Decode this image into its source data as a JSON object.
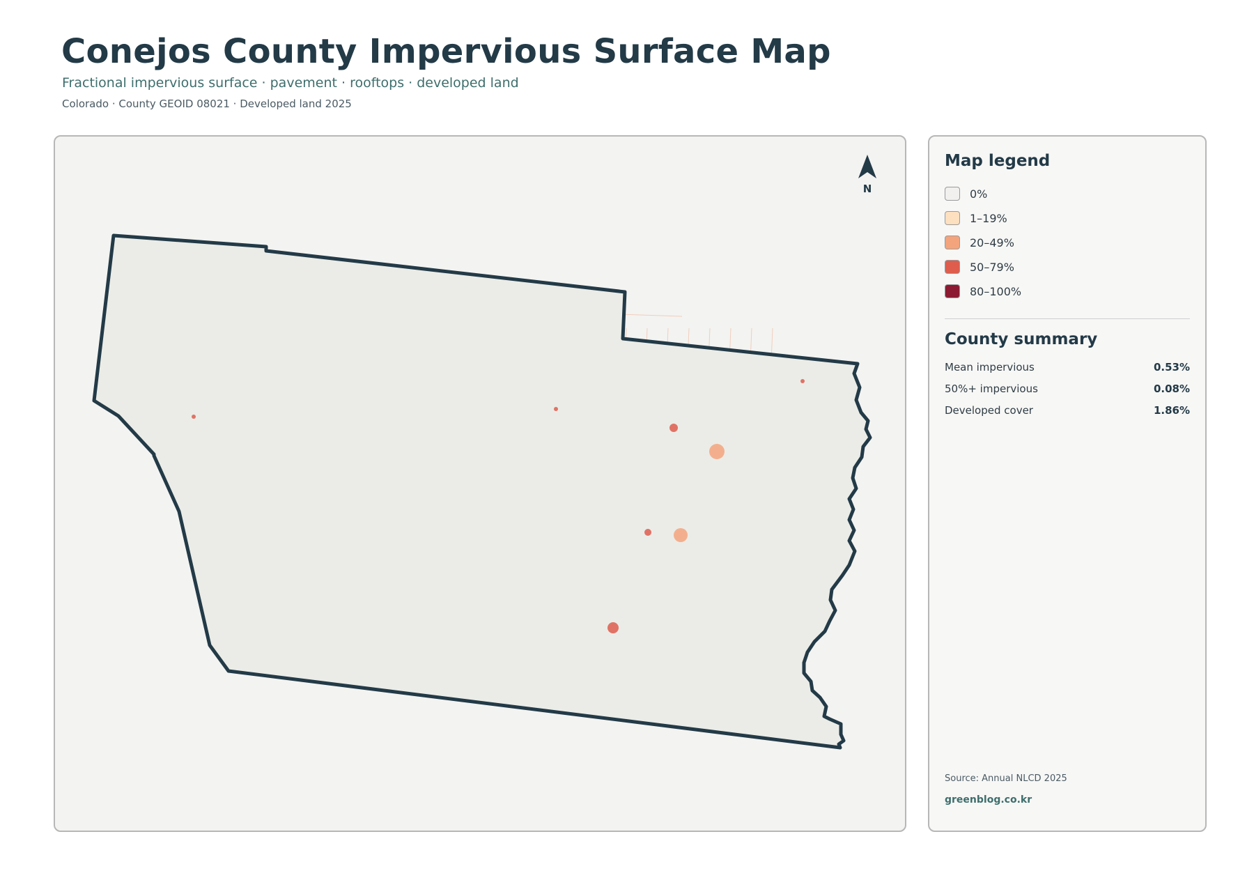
{
  "header": {
    "title": "Conejos County Impervious Surface Map",
    "subtitle": "Fractional impervious surface · pavement · rooftops · developed land",
    "meta": "Colorado · County GEOID 08021 · Developed land 2025"
  },
  "map": {
    "north_label": "N",
    "fill_color": "#ebece7",
    "outline_color": "#233a47",
    "road_color": "#f0a07e",
    "icon": "north-arrow-icon"
  },
  "legend": {
    "title": "Map legend",
    "classes": [
      {
        "label": "0%",
        "color": "#f1f0ee"
      },
      {
        "label": "1–19%",
        "color": "#fde0bf"
      },
      {
        "label": "20–49%",
        "color": "#f4a47c"
      },
      {
        "label": "50–79%",
        "color": "#de5d4d"
      },
      {
        "label": "80–100%",
        "color": "#8c1a32"
      }
    ]
  },
  "summary": {
    "title": "County summary",
    "rows": [
      {
        "label": "Mean impervious",
        "value": "0.53%"
      },
      {
        "label": "50%+ impervious",
        "value": "0.08%"
      },
      {
        "label": "Developed cover",
        "value": "1.86%"
      }
    ]
  },
  "footer": {
    "source": "Source: Annual NLCD 2025",
    "site": "greenblog.co.kr"
  }
}
